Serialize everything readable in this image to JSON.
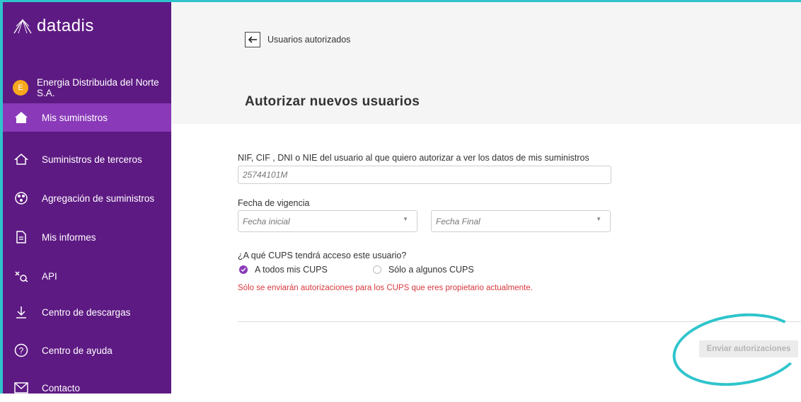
{
  "app": {
    "logo_text": "datadis"
  },
  "sidebar": {
    "company_initial": "E",
    "company_name": "Energia Distribuida del Norte S.A.",
    "items": [
      {
        "label": "Mis suministros",
        "icon": "home-icon",
        "active": true
      },
      {
        "label": "Suministros de terceros",
        "icon": "house-outline-icon"
      },
      {
        "label": "Agregación de suministros",
        "icon": "aggregation-icon"
      },
      {
        "label": "Mis informes",
        "icon": "document-icon"
      },
      {
        "label": "API",
        "icon": "api-icon"
      },
      {
        "label": "Centro de descargas",
        "icon": "download-icon"
      },
      {
        "label": "Centro de ayuda",
        "icon": "help-icon"
      },
      {
        "label": "Contacto",
        "icon": "mail-icon"
      }
    ]
  },
  "header": {
    "back_label": "Usuarios autorizados",
    "title": "Autorizar nuevos usuarios"
  },
  "form": {
    "nif_label": "NIF, CIF , DNI o NIE del usuario al que quiero autorizar a ver los datos de mis suministros",
    "nif_value": "25744101M",
    "date_label": "Fecha de vigencia",
    "start_placeholder": "Fecha inicial",
    "end_placeholder": "Fecha Final",
    "cups_question": "¿A qué CUPS tendrá acceso este usuario?",
    "option_all": "A todos mis CUPS",
    "option_some": "Sólo a algunos CUPS",
    "selected_option": "A todos mis CUPS",
    "note": "Sólo se enviarán autorizaciones para los CUPS que eres propietario actualmente.",
    "submit_label": "Enviar autorizaciones"
  },
  "colors": {
    "sidebar_bg": "#5e1a83",
    "sidebar_active": "#8a3ab9",
    "accent": "#2fc4cc",
    "note_red": "#d9383e"
  }
}
